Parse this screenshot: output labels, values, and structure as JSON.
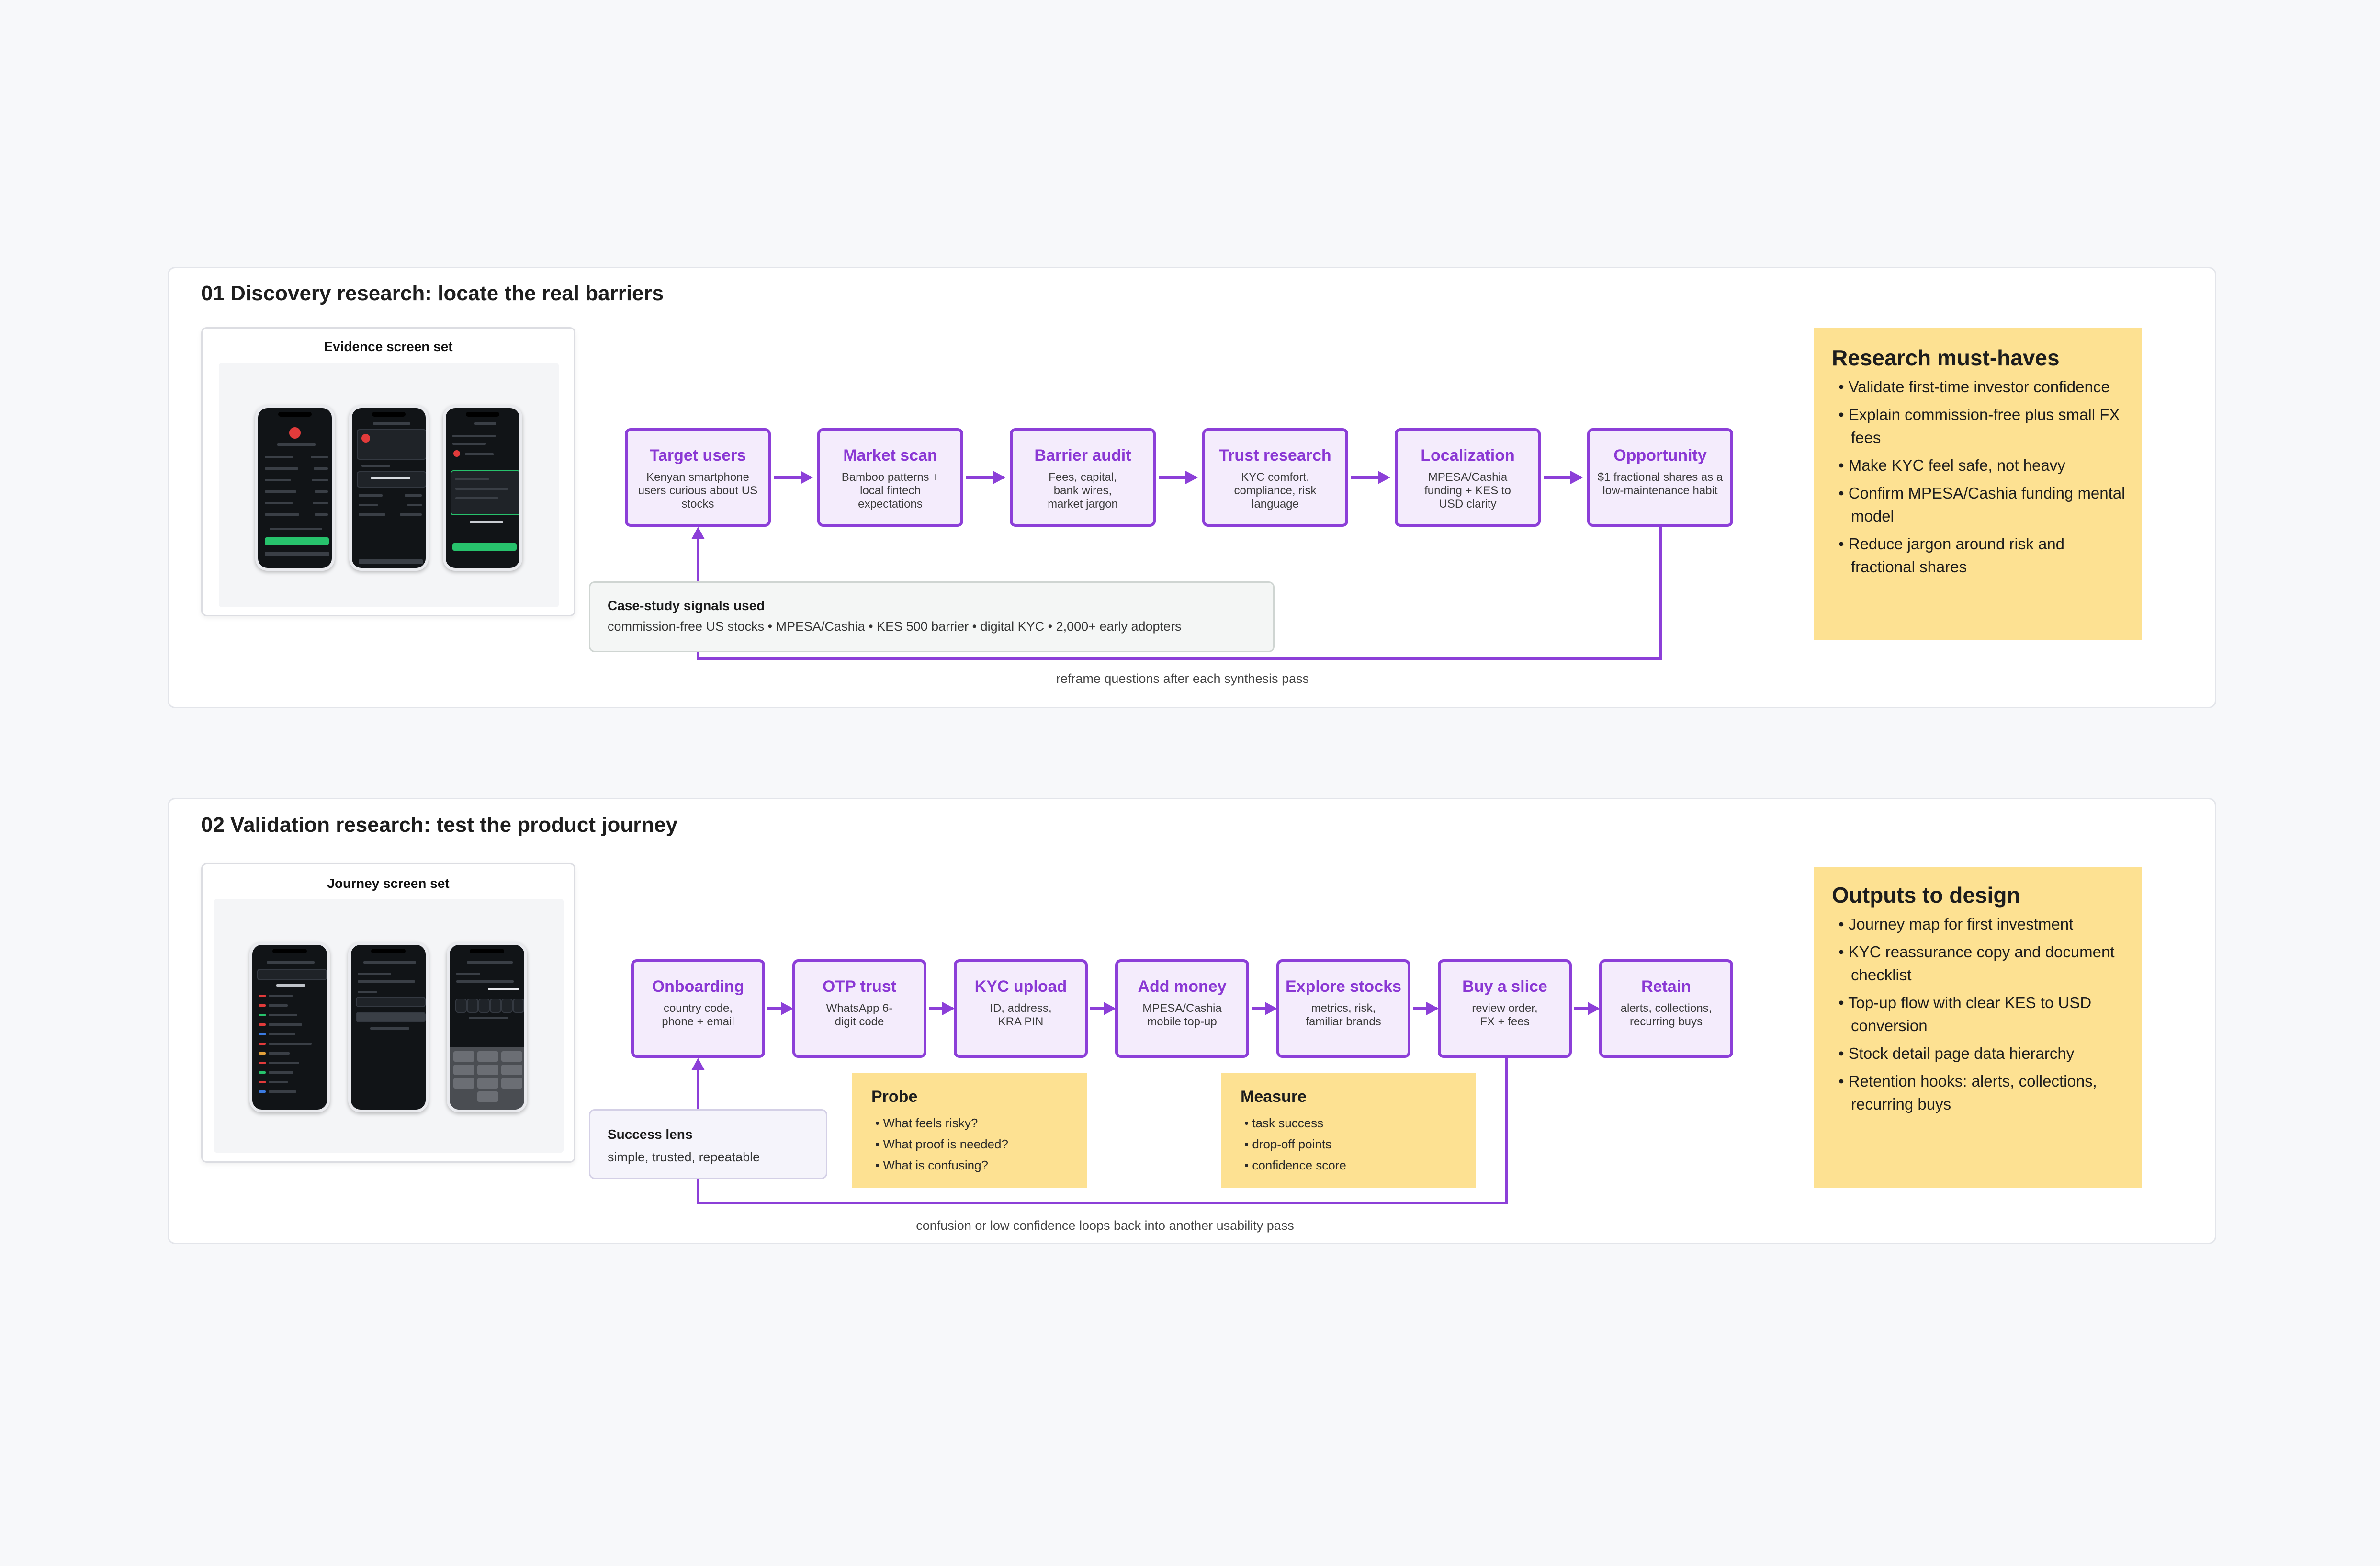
{
  "section1": {
    "title": "01  Discovery research: locate the real barriers",
    "evidence_title": "Evidence screen set",
    "steps": [
      {
        "title": "Target users",
        "desc": "Kenyan smartphone users curious about US stocks"
      },
      {
        "title": "Market scan",
        "desc": "Bamboo patterns + local fintech expectations"
      },
      {
        "title": "Barrier audit",
        "desc": "Fees, capital, bank wires, market jargon"
      },
      {
        "title": "Trust research",
        "desc": "KYC comfort, compliance, risk language"
      },
      {
        "title": "Localization",
        "desc": "MPESA/Cashia funding + KES to USD clarity"
      },
      {
        "title": "Opportunity",
        "desc": "$1 fractional shares as a low-maintenance habit"
      }
    ],
    "signals": {
      "title": "Case-study signals used",
      "text": "commission-free US stocks • MPESA/Cashia • KES 500 barrier • digital KYC • 2,000+ early adopters"
    },
    "loop_caption": "reframe questions after each synthesis pass",
    "must_haves": {
      "title": "Research must-haves",
      "items": [
        "Validate first-time investor confidence",
        "Explain commission-free plus small FX fees",
        "Make KYC feel safe, not heavy",
        "Confirm MPESA/Cashia funding mental model",
        "Reduce jargon around risk and fractional shares"
      ]
    }
  },
  "section2": {
    "title": "02  Validation research: test the product journey",
    "journey_title": "Journey screen set",
    "steps": [
      {
        "title": "Onboarding",
        "desc": "country code, phone + email"
      },
      {
        "title": "OTP trust",
        "desc": "WhatsApp 6-digit code"
      },
      {
        "title": "KYC upload",
        "desc": "ID, address, KRA PIN"
      },
      {
        "title": "Add money",
        "desc": "MPESA/Cashia mobile top-up"
      },
      {
        "title": "Explore stocks",
        "desc": "metrics, risk, familiar brands"
      },
      {
        "title": "Buy a slice",
        "desc": "review order, FX + fees"
      },
      {
        "title": "Retain",
        "desc": "alerts, collections, recurring buys"
      }
    ],
    "success": {
      "title": "Success lens",
      "text": "simple, trusted, repeatable"
    },
    "probe": {
      "title": "Probe",
      "items": [
        "What feels risky?",
        "What proof is needed?",
        "What is confusing?"
      ]
    },
    "measure": {
      "title": "Measure",
      "items": [
        "task success",
        "drop-off points",
        "confidence score"
      ]
    },
    "loop_caption": "confusion or low confidence loops back into another usability pass",
    "outputs": {
      "title": "Outputs to design",
      "items": [
        "Journey map for first investment",
        "KYC reassurance copy and document checklist",
        "Top-up flow with clear KES to USD conversion",
        "Stock detail page data hierarchy",
        "Retention hooks: alerts, collections, recurring buys"
      ]
    }
  },
  "colors": {
    "accent": "#8c3fd8",
    "step_fill": "#f4ecfc",
    "highlight": "#fde192",
    "background": "#f7f8fa"
  }
}
